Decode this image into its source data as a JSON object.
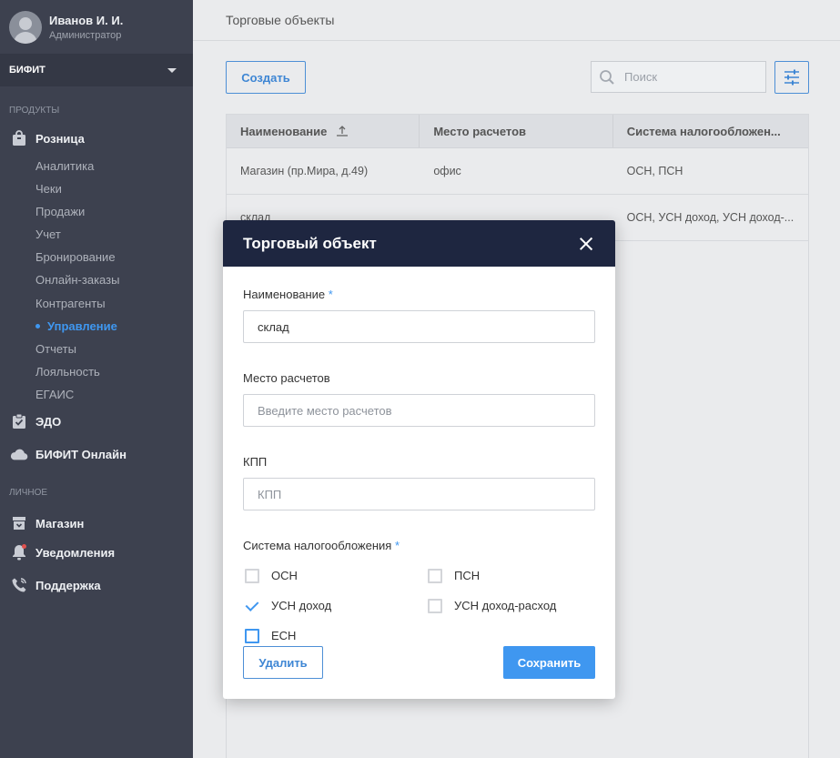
{
  "user": {
    "name": "Иванов И. И.",
    "role": "Администратор"
  },
  "org": {
    "name": "БИФИТ"
  },
  "sidebar": {
    "section_products": "ПРОДУКТЫ",
    "retail": "Розница",
    "retail_items": [
      "Аналитика",
      "Чеки",
      "Продажи",
      "Учет",
      "Бронирование",
      "Онлайн-заказы",
      "Контрагенты",
      "Управление",
      "Отчеты",
      "Лояльность",
      "ЕГАИС"
    ],
    "edo": "ЭДО",
    "bifit_online": "БИФИТ Онлайн",
    "section_personal": "ЛИЧНОЕ",
    "shop": "Магазин",
    "notifications": "Уведомления",
    "support": "Поддержка"
  },
  "page": {
    "title": "Торговые объекты"
  },
  "toolbar": {
    "create_label": "Создать",
    "search_placeholder": "Поиск"
  },
  "table": {
    "columns": [
      "Наименование",
      "Место расчетов",
      "Система налогообложен..."
    ],
    "rows": [
      [
        "Магазин (пр.Мира, д.49)",
        "офис",
        "ОСН, ПСН"
      ],
      [
        "склад",
        "",
        "ОСН, УСН доход, УСН доход-..."
      ]
    ]
  },
  "modal": {
    "title": "Торговый объект",
    "name_label": "Наименование",
    "name_value": "склад",
    "place_label": "Место расчетов",
    "place_placeholder": "Введите место расчетов",
    "kpp_label": "КПП",
    "kpp_placeholder": "КПП",
    "tax_label": "Система налогообложения",
    "required_mark": "*",
    "tax_options": [
      {
        "label": "ОСН",
        "checked": false
      },
      {
        "label": "ПСН",
        "checked": false
      },
      {
        "label": "УСН доход",
        "checked": true
      },
      {
        "label": "УСН доход-расход",
        "checked": false
      },
      {
        "label": "ЕСН",
        "checked": false
      }
    ],
    "delete_label": "Удалить",
    "save_label": "Сохранить"
  }
}
